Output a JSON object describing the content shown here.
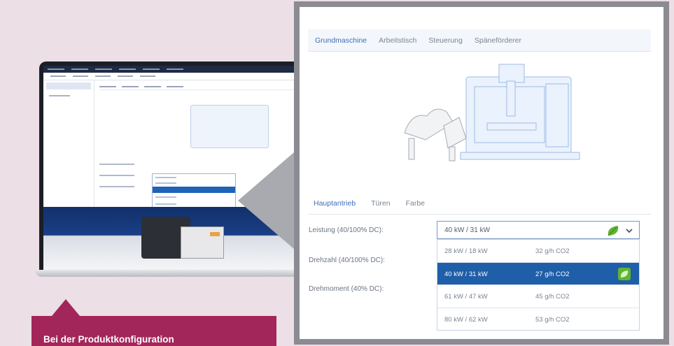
{
  "caption": {
    "text": "Bei der Produktkonfiguration"
  },
  "panel": {
    "tabs": [
      {
        "label": "Grundmaschine",
        "active": true
      },
      {
        "label": "Arbeitstisch",
        "active": false
      },
      {
        "label": "Steuerung",
        "active": false
      },
      {
        "label": "Späneförderer",
        "active": false
      }
    ],
    "subtabs": [
      {
        "label": "Hauptantrieb",
        "active": true
      },
      {
        "label": "Türen",
        "active": false
      },
      {
        "label": "Farbe",
        "active": false
      }
    ],
    "fields": {
      "leistung": "Leistung (40/100% DC):",
      "drehzahl": "Drehzahl (40/100% DC):",
      "drehmoment": "Drehmoment (40% DC):"
    },
    "select": {
      "value": "40 kW / 31 kW",
      "options": [
        {
          "power": "28 kW / 18 kW",
          "co2": "32 g/h CO2",
          "selected": false
        },
        {
          "power": "40 kW / 31 kW",
          "co2": "27 g/h CO2",
          "selected": true
        },
        {
          "power": "61 kW / 47 kW",
          "co2": "45 g/h CO2",
          "selected": false
        },
        {
          "power": "80 kW / 62 kW",
          "co2": "53 g/h CO2",
          "selected": false
        }
      ]
    }
  },
  "colors": {
    "accent": "#3e6fb7",
    "selected_row": "#1f5ea8",
    "eco_green": "#5fb52f",
    "caption_bg": "#a3265a",
    "background": "#ecdfe6"
  },
  "icons": {
    "eco": "leaf-icon",
    "dropdown": "chevron-down-icon"
  }
}
